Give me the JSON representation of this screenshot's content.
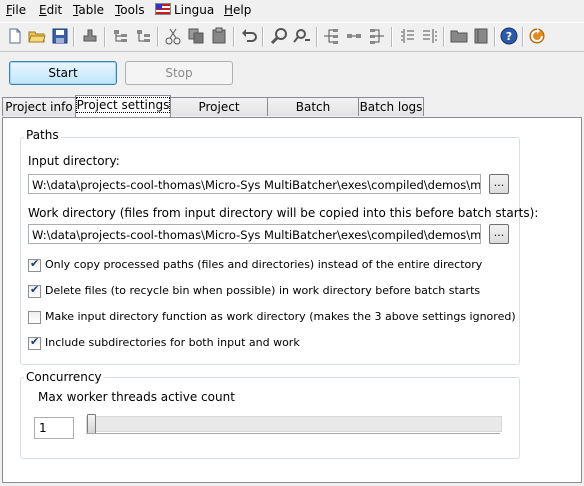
{
  "menu": [
    {
      "label": "File",
      "accel": "F",
      "rest": "ile"
    },
    {
      "label": "Edit",
      "accel": "E",
      "rest": "dit"
    },
    {
      "label": "Table",
      "accel": "T",
      "rest": "able"
    },
    {
      "label": "Tools",
      "accel": "T",
      "rest": "ools"
    },
    {
      "label": "Lingua",
      "accel": "",
      "rest": "Lingua"
    },
    {
      "label": "Help",
      "accel": "H",
      "rest": "elp"
    }
  ],
  "toolbar_icons": [
    "new-file-icon",
    "open-folder-icon",
    "save-icon",
    "stamp-icon",
    "copy-tree-icon",
    "paste-tree-icon",
    "cut-icon",
    "copy-icon",
    "paste-icon",
    "undo-icon",
    "find-icon",
    "find-replace-icon",
    "tree-left-icon",
    "tree-expand-icon",
    "tree-right-icon",
    "outdent-icon",
    "indent-icon",
    "folder-icon",
    "notebook-icon",
    "help-icon",
    "refresh-icon"
  ],
  "buttons": {
    "start": "Start",
    "stop": "Stop"
  },
  "tabs": [
    "Project info",
    "Project settings",
    "Project modules",
    "Batch progress",
    "Batch logs"
  ],
  "active_tab": "Project settings",
  "paths": {
    "group_title": "Paths",
    "input_label": "Input directory:",
    "input_value": "W:\\data\\projects-cool-thomas\\Micro-Sys MultiBatcher\\exes\\compiled\\demos\\most",
    "work_label": "Work directory (files from input directory will be copied into this before batch starts):",
    "work_value": "W:\\data\\projects-cool-thomas\\Micro-Sys MultiBatcher\\exes\\compiled\\demos\\most",
    "browse_label": "...",
    "options": [
      {
        "label": "Only copy processed paths (files and directories) instead of the entire directory",
        "checked": true
      },
      {
        "label": "Delete files (to recycle bin when possible) in work directory before batch starts",
        "checked": true
      },
      {
        "label": "Make input directory function as work directory (makes the 3 above settings ignored)",
        "checked": false
      },
      {
        "label": "Include subdirectories for both input and work",
        "checked": true
      }
    ]
  },
  "concurrency": {
    "group_title": "Concurrency",
    "threads_label": "Max worker threads active count",
    "threads_value": "1",
    "slider_fraction": 0.0
  },
  "colors": {
    "accent": "#3c7fb1",
    "panel_border": "#898c95",
    "group_border": "#d5dfe5"
  }
}
